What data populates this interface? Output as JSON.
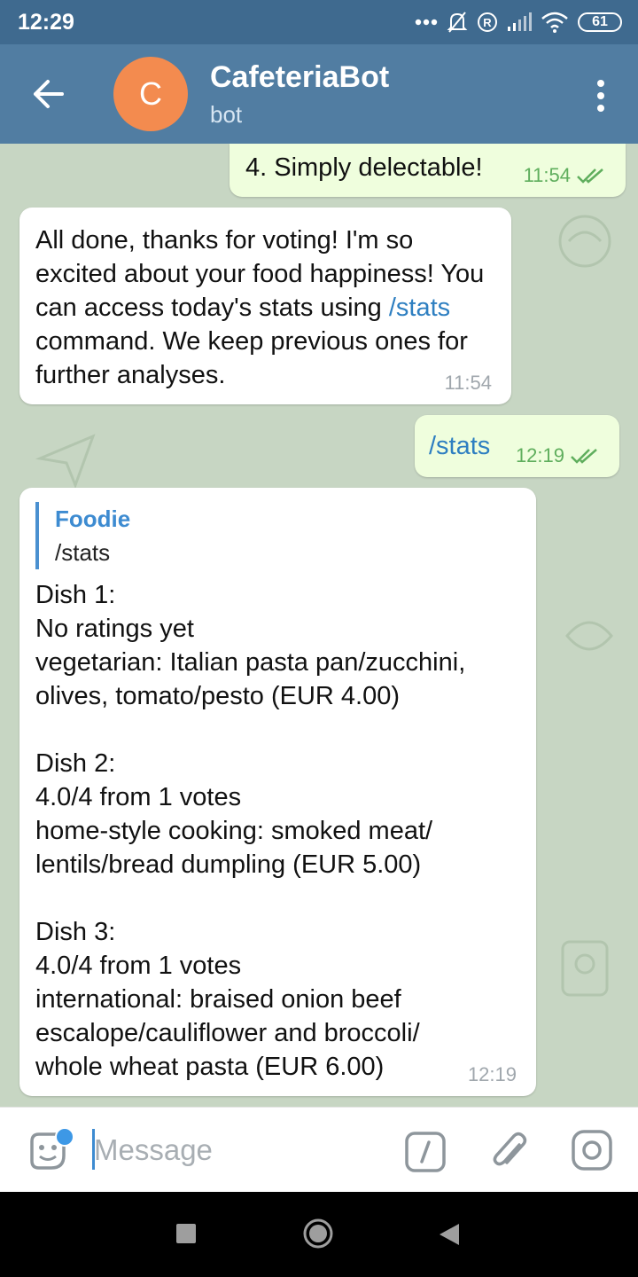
{
  "status_bar": {
    "time": "12:29",
    "battery": "61"
  },
  "header": {
    "title": "CafeteriaBot",
    "subtitle": "bot",
    "avatar_letter": "C"
  },
  "messages": [
    {
      "text": "4. Simply delectable!",
      "time": "11:54"
    },
    {
      "text_before_link": "All done, thanks for voting! I'm so excited about your food happiness! You can access today's stats using ",
      "link": "/stats",
      "text_after_link": " command. We keep previous ones for further analyses.",
      "time": "11:54"
    },
    {
      "link": "/stats",
      "time": "12:19"
    },
    {
      "quote_name": "Foodie",
      "quote_text": "/stats",
      "lines": [
        "Dish 1:",
        "No ratings yet",
        "vegetarian: Italian pasta pan/zucchini,",
        "olives, tomato/pesto (EUR 4.00)",
        "",
        "Dish 2:",
        "4.0/4 from 1 votes",
        "home-style cooking: smoked meat/",
        "lentils/bread dumpling (EUR 5.00)",
        "",
        "Dish 3:",
        "4.0/4 from 1 votes",
        "international: braised onion beef",
        "escalope/cauliflower and broccoli/",
        "whole wheat pasta (EUR 6.00)"
      ],
      "time": "12:19"
    }
  ],
  "input": {
    "placeholder": "Message"
  },
  "colors": {
    "header": "#517da2",
    "status_bar": "#3f6a8f",
    "outgoing_bubble": "#effedd",
    "link": "#2e7fc1"
  },
  "icons": [
    "back-arrow-icon",
    "more-vert-icon",
    "sticker-icon",
    "command-icon",
    "paperclip-icon",
    "camera-icon",
    "double-check-icon"
  ]
}
